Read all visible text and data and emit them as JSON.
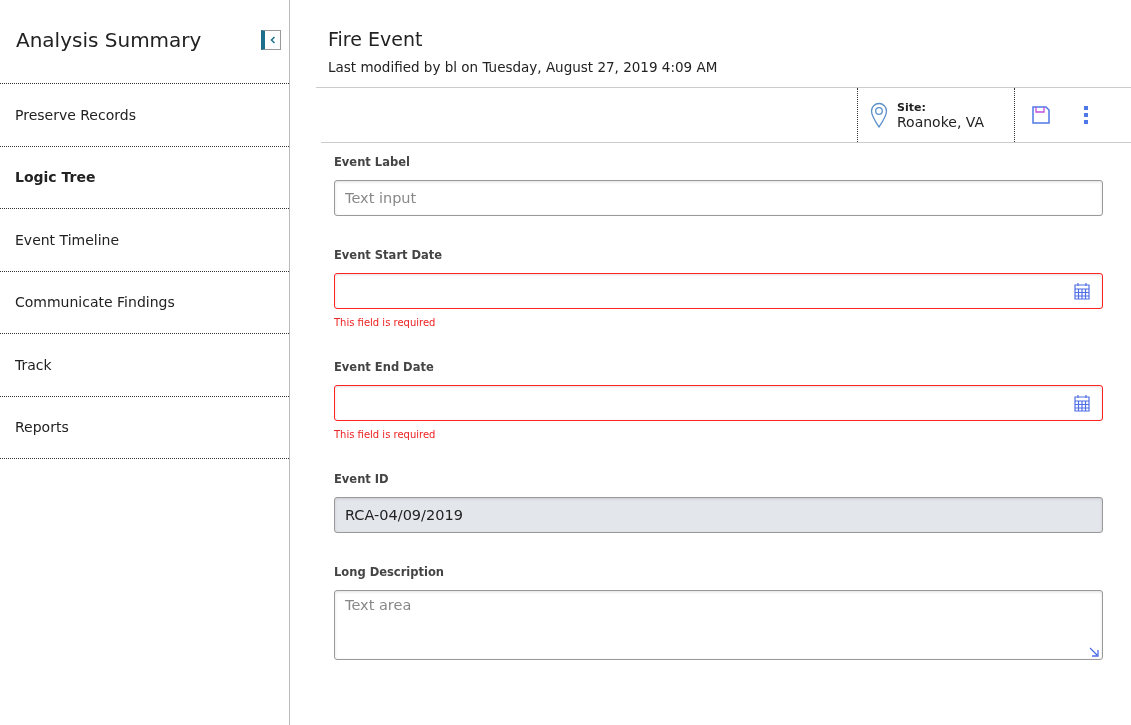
{
  "sidebar": {
    "title": "Analysis Summary",
    "items": [
      {
        "label": "Preserve Records",
        "selected": false
      },
      {
        "label": "Logic Tree",
        "selected": true
      },
      {
        "label": "Event Timeline",
        "selected": false
      },
      {
        "label": "Communicate Findings",
        "selected": false
      },
      {
        "label": "Track",
        "selected": false
      },
      {
        "label": "Reports",
        "selected": false
      }
    ]
  },
  "header": {
    "title": "Fire Event",
    "subtitle": "Last modified by bl on Tuesday, August 27, 2019 4:09 AM"
  },
  "toolbar": {
    "site_label": "Site:",
    "site_value": "Roanoke, VA"
  },
  "fields": [
    {
      "kind": "text",
      "label": "Event Label",
      "placeholder": "Text input"
    },
    {
      "kind": "date",
      "label": "Event Start Date",
      "error": "This field is required"
    },
    {
      "kind": "date",
      "label": "Event End Date",
      "error": "This field is required"
    },
    {
      "kind": "readonly",
      "label": "Event ID",
      "value": "RCA-04/09/2019"
    },
    {
      "kind": "textarea",
      "label": "Long Description",
      "placeholder": "Text area"
    }
  ]
}
